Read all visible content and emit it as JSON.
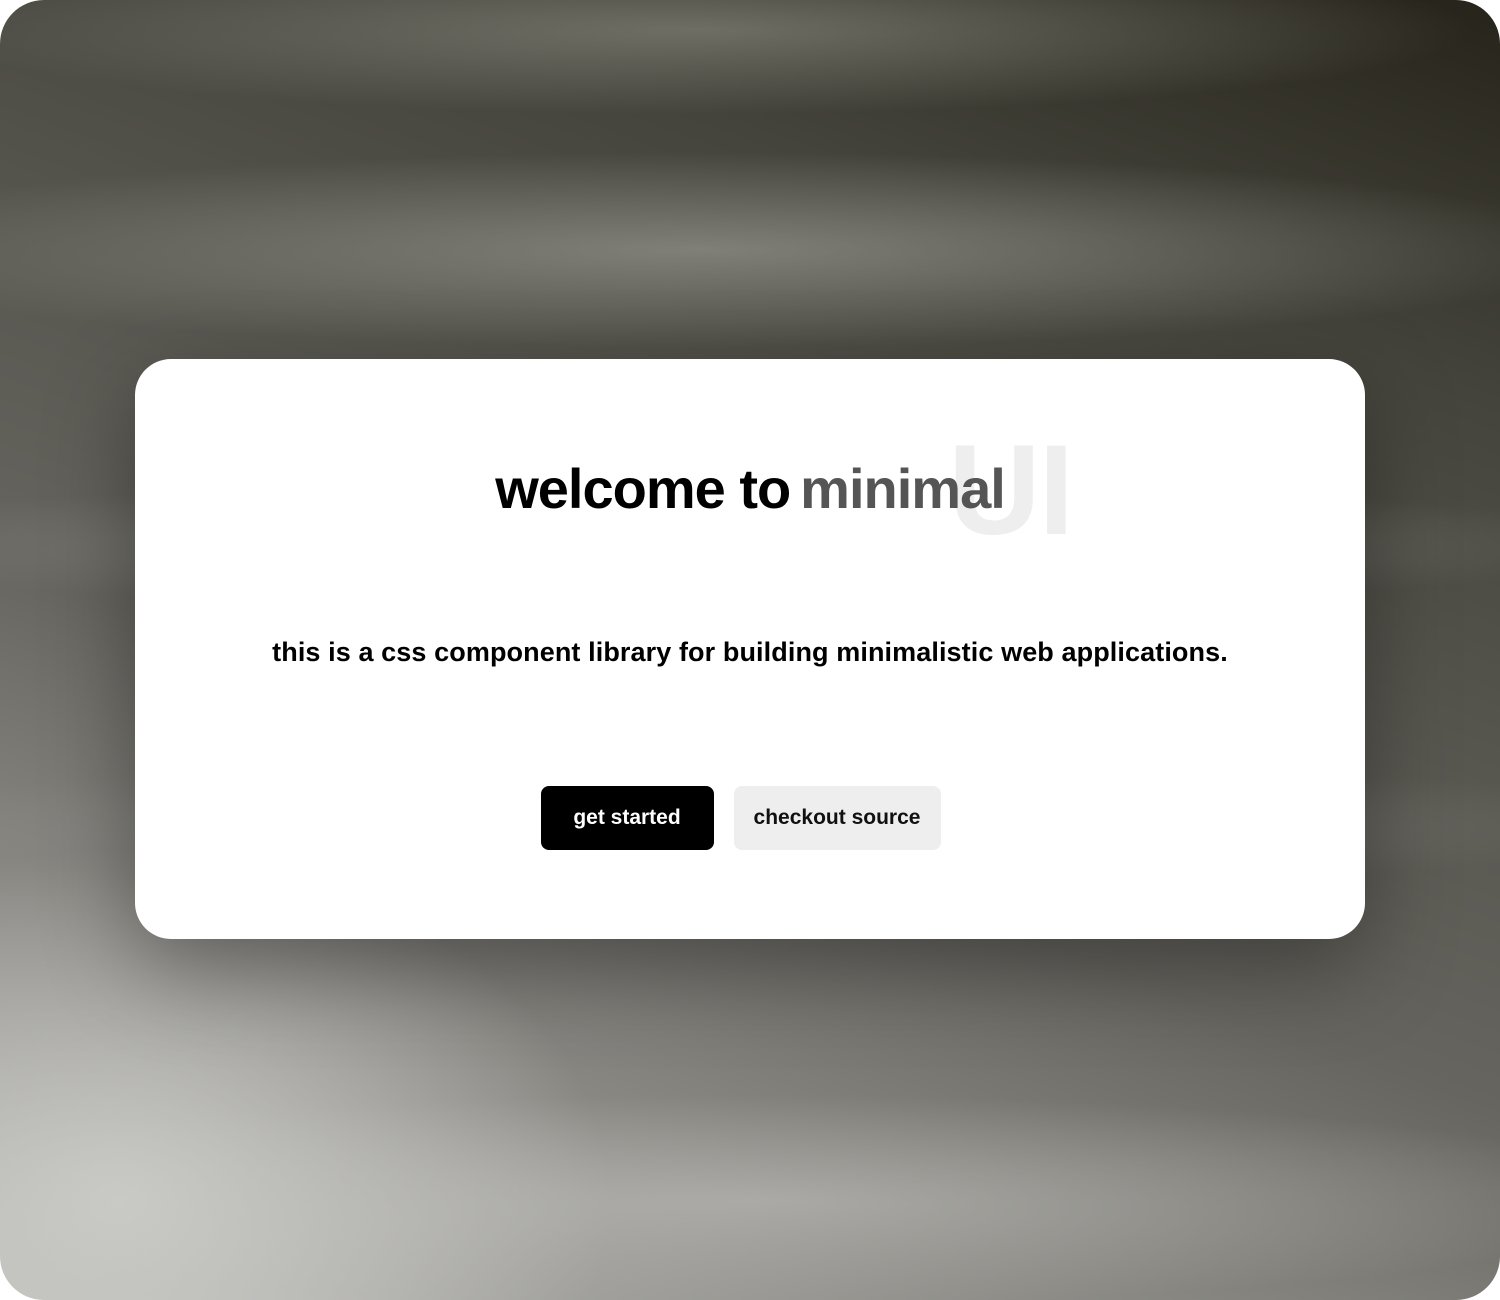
{
  "hero": {
    "title_prefix": "welcome to",
    "brand_word": "minimal",
    "brand_mark": "UI",
    "subtitle": "this is a css component library for building minimalistic web applications."
  },
  "actions": {
    "primary_label": "get started",
    "secondary_label": "checkout source"
  },
  "colors": {
    "primary_button_bg": "#000000",
    "secondary_button_bg": "#eeeeee",
    "brand_word": "#555555",
    "brand_mark": "#eeeeee",
    "card_bg": "#ffffff"
  }
}
